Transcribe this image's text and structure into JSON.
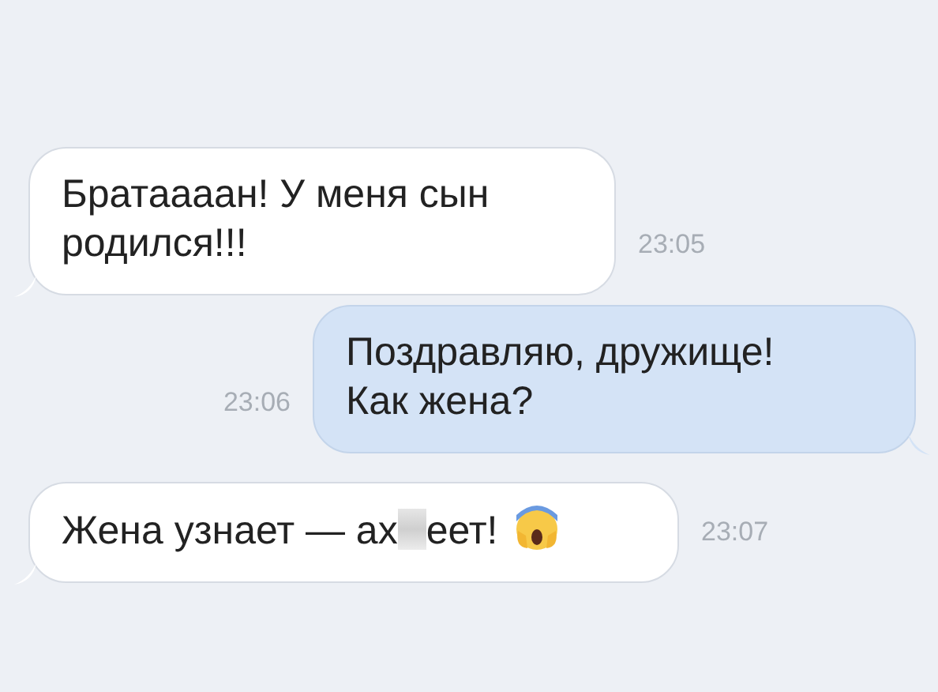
{
  "messages": [
    {
      "kind": "incoming",
      "segments": [
        {
          "kind": "text",
          "text": "Братаааан! У меня сын родился!!!"
        }
      ],
      "time": "23:05"
    },
    {
      "kind": "outgoing",
      "segments": [
        {
          "kind": "text",
          "text": "Поздравляю, дружище! Как жена?"
        }
      ],
      "time": "23:06"
    },
    {
      "kind": "incoming",
      "segments": [
        {
          "kind": "text",
          "text": "Жена узнает — ах"
        },
        {
          "kind": "censored"
        },
        {
          "kind": "text",
          "text": "еет!"
        },
        {
          "kind": "emoji"
        }
      ],
      "time": "23:07"
    }
  ]
}
